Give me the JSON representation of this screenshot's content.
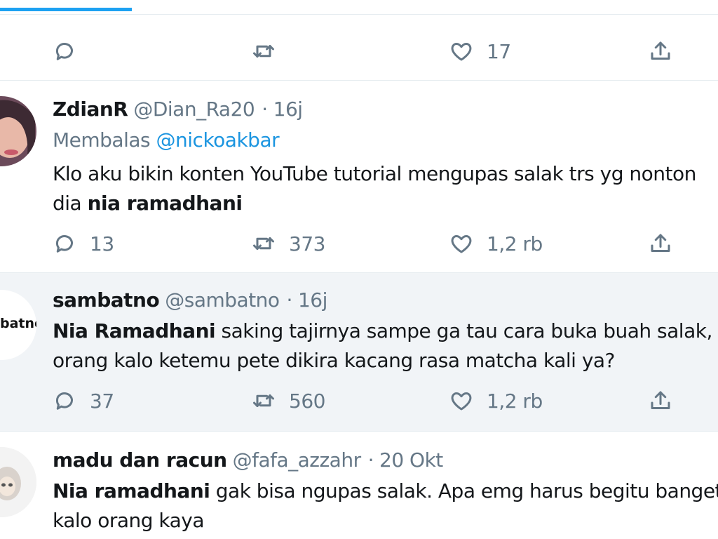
{
  "top_actions": {
    "like_count": "17"
  },
  "tweets": [
    {
      "name": "ZdianR",
      "handle": "@Dian_Ra20",
      "time": "16j",
      "reply_prefix": "Membalas",
      "reply_to": "@nickoakbar",
      "line1": "Klo aku bikin konten YouTube tutorial mengupas salak trs yg nonton",
      "line2_prefix": "dia ",
      "line2_bold": "nia ramadhani",
      "reply_count": "13",
      "retweet_count": "373",
      "like_count": "1,2 rb"
    },
    {
      "name": "sambatno",
      "handle": "@sambatno",
      "time": "16j",
      "avatar_text": "batno",
      "line1_bold": "Nia Ramadhani",
      "line1_rest": " saking tajirnya sampe ga tau cara buka buah salak, i",
      "line2": "orang kalo ketemu pete dikira kacang rasa matcha kali ya?",
      "reply_count": "37",
      "retweet_count": "560",
      "like_count": "1,2 rb"
    },
    {
      "name": "madu dan racun",
      "handle": "@fafa_azzahr",
      "time": "20 Okt",
      "line1_bold": "Nia ramadhani",
      "line1_rest": " gak bisa ngupas salak. Apa emg harus begitu banget",
      "line2": "kalo orang kaya"
    }
  ],
  "colors": {
    "accent": "#1da1f2",
    "mention": "#1b95e0",
    "muted": "#657786",
    "highlight_bg": "#f1f4f7"
  },
  "icons": [
    "reply-icon",
    "retweet-icon",
    "like-icon",
    "share-icon"
  ]
}
